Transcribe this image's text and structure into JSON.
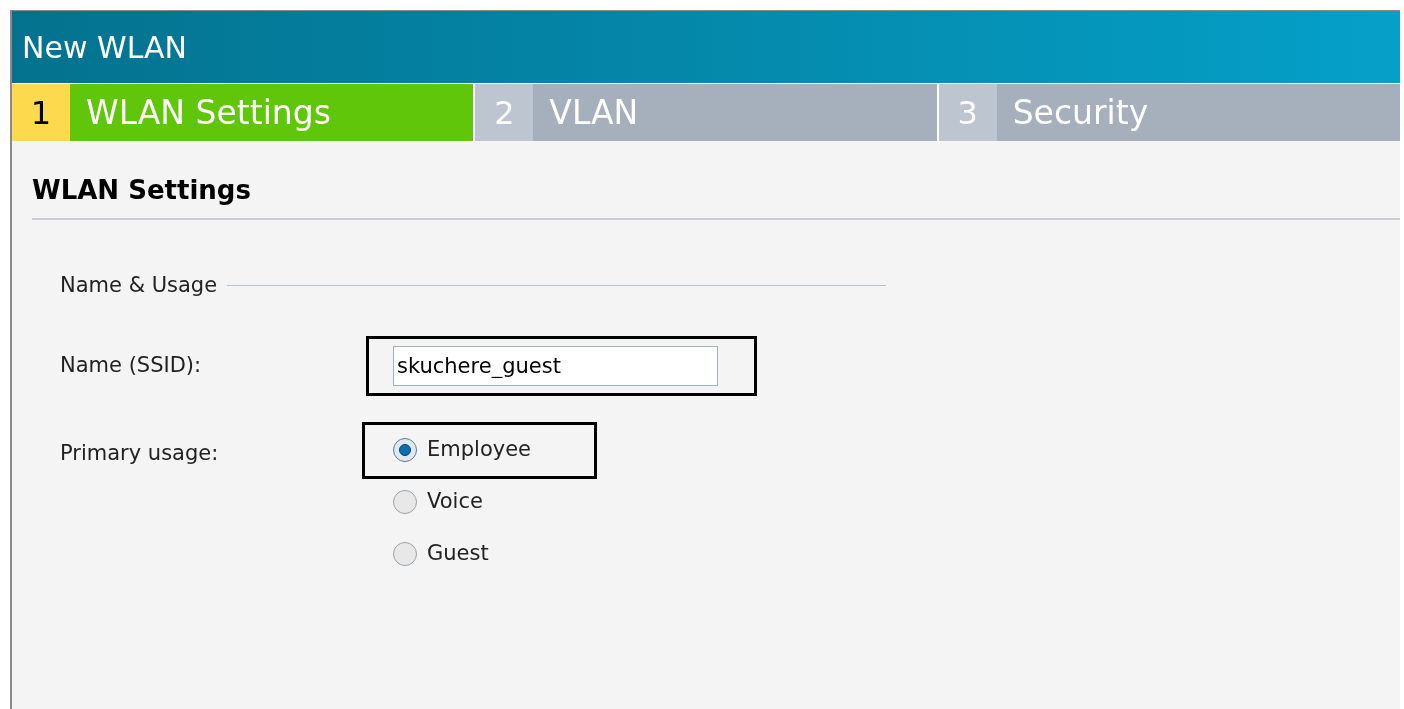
{
  "window": {
    "title": "New WLAN"
  },
  "steps": [
    {
      "number": "1",
      "label": "WLAN Settings",
      "selected": true
    },
    {
      "number": "2",
      "label": "VLAN",
      "selected": false
    },
    {
      "number": "3",
      "label": "Security",
      "selected": false
    }
  ],
  "section": {
    "title": "WLAN Settings"
  },
  "fieldset": {
    "legend": "Name & Usage"
  },
  "ssid": {
    "label": "Name (SSID):",
    "value": "skuchere_guest",
    "highlighted": true
  },
  "usage": {
    "label": "Primary usage:",
    "options": [
      {
        "label": "Employee",
        "selected": true,
        "highlighted": true
      },
      {
        "label": "Voice",
        "selected": false,
        "highlighted": false
      },
      {
        "label": "Guest",
        "selected": false,
        "highlighted": false
      }
    ]
  }
}
